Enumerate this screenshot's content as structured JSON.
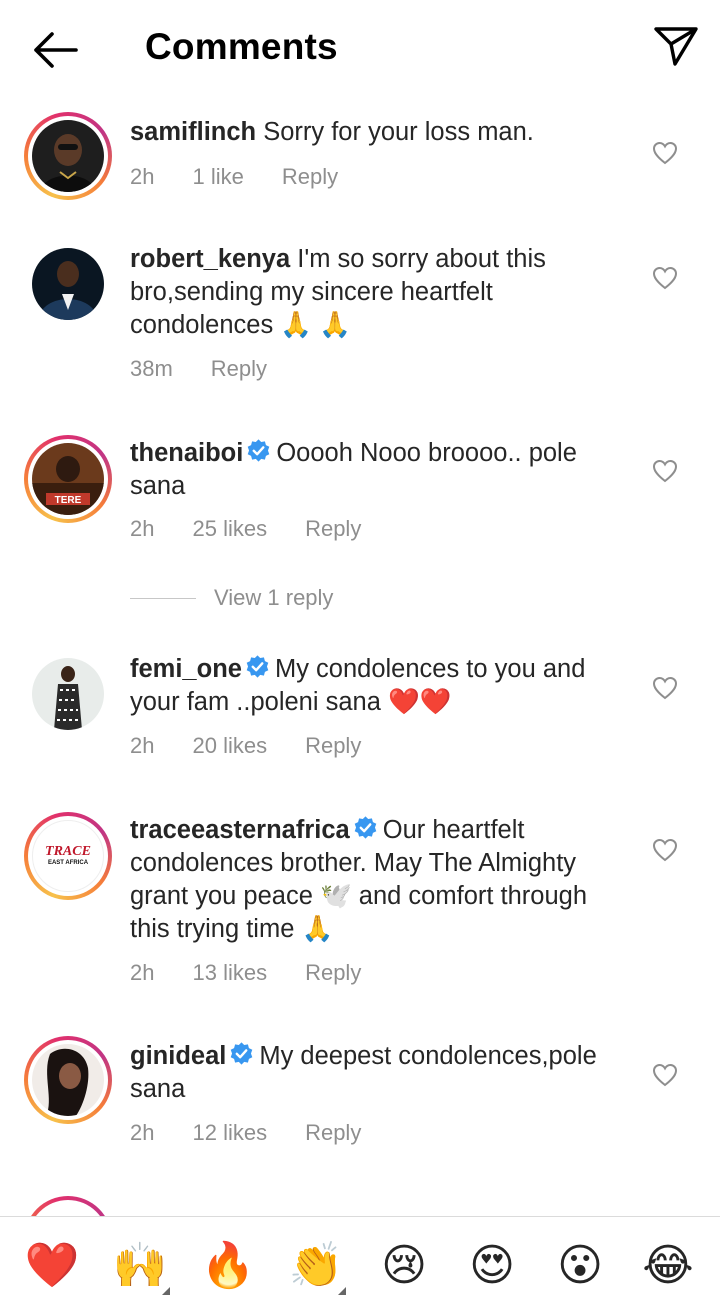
{
  "header": {
    "title": "Comments",
    "back_icon": "arrow-left-icon",
    "send_icon": "paper-plane-icon"
  },
  "comments": [
    {
      "username": "samiflinch",
      "verified": false,
      "text": "Sorry for your loss man.",
      "time": "2h",
      "likes": "1 like",
      "reply": "Reply"
    },
    {
      "username": "robert_kenya",
      "verified": false,
      "text": "I'm so sorry about this bro,sending my sincere heartfelt condolences 🙏 🙏",
      "time": "38m",
      "likes": "",
      "reply": "Reply"
    },
    {
      "username": "thenaiboi",
      "verified": true,
      "text": "Ooooh Nooo broooo.. pole sana",
      "time": "2h",
      "likes": "25 likes",
      "reply": "Reply",
      "view_replies": "View 1 reply"
    },
    {
      "username": "femi_one",
      "verified": true,
      "text": "My condolences to you and your fam ..poleni sana ❤️❤️",
      "time": "2h",
      "likes": "20 likes",
      "reply": "Reply"
    },
    {
      "username": "traceeasternafrica",
      "verified": true,
      "text": "Our heartfelt condolences brother. May The Almighty grant you peace 🕊️ and comfort through this trying time 🙏",
      "time": "2h",
      "likes": "13 likes",
      "reply": "Reply",
      "avatar_logo": "TRACE",
      "avatar_sub": "EAST AFRICA"
    },
    {
      "username": "ginideal",
      "verified": true,
      "text": "My deepest condolences,pole sana",
      "time": "2h",
      "likes": "12 likes",
      "reply": "Reply"
    }
  ],
  "emoji_bar": [
    {
      "emoji": "❤️",
      "name": "heart"
    },
    {
      "emoji": "🙌",
      "name": "raised-hands",
      "tones": true
    },
    {
      "emoji": "🔥",
      "name": "fire"
    },
    {
      "emoji": "👏",
      "name": "clap",
      "tones": true
    },
    {
      "emoji": "😢",
      "name": "crying"
    },
    {
      "emoji": "😍",
      "name": "heart-eyes"
    },
    {
      "emoji": "😮",
      "name": "open-mouth"
    },
    {
      "emoji": "😂",
      "name": "tears-of-joy"
    }
  ],
  "colors": {
    "verified": "#3897f0",
    "meta": "#8e8e8e",
    "text": "#262626"
  }
}
